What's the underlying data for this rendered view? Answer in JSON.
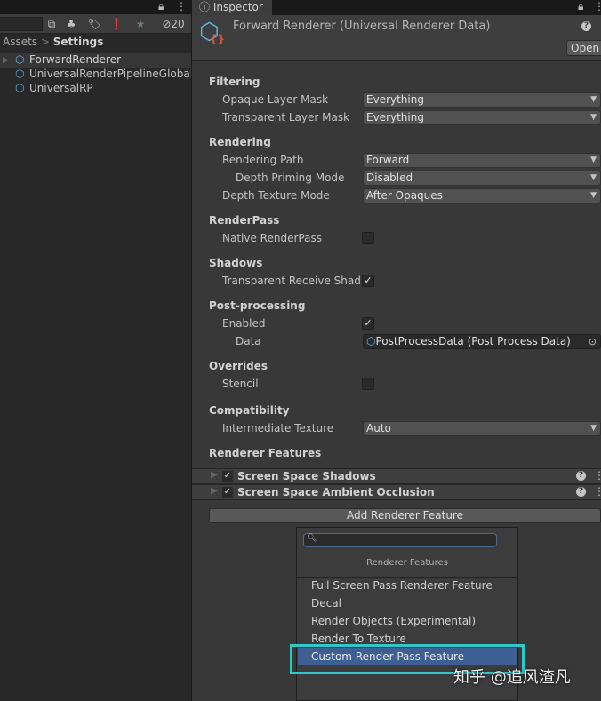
{
  "project": {
    "hidden_count": "20",
    "breadcrumb_root": "Assets",
    "breadcrumb_current": "Settings",
    "items": [
      "ForwardRenderer",
      "UniversalRenderPipelineGlobalSettings",
      "UniversalRP"
    ]
  },
  "inspector": {
    "tab": "Inspector",
    "title": "Forward Renderer (Universal Renderer Data)",
    "open_label": "Open"
  },
  "sections": {
    "filtering": "Filtering",
    "rendering": "Rendering",
    "renderpass": "RenderPass",
    "shadows": "Shadows",
    "post": "Post-processing",
    "overrides": "Overrides",
    "compat": "Compatibility",
    "features": "Renderer Features"
  },
  "fields": {
    "opaque": {
      "label": "Opaque Layer Mask",
      "value": "Everything"
    },
    "transparent": {
      "label": "Transparent Layer Mask",
      "value": "Everything"
    },
    "path": {
      "label": "Rendering Path",
      "value": "Forward"
    },
    "priming": {
      "label": "Depth Priming Mode",
      "value": "Disabled"
    },
    "depthtex": {
      "label": "Depth Texture Mode",
      "value": "After Opaques"
    },
    "native": {
      "label": "Native RenderPass",
      "checked": false
    },
    "transshadow": {
      "label": "Transparent Receive Shadows",
      "checked": true
    },
    "enabled": {
      "label": "Enabled",
      "checked": true
    },
    "data": {
      "label": "Data",
      "value": "PostProcessData (Post Process Data)"
    },
    "stencil": {
      "label": "Stencil",
      "checked": false
    },
    "intermediate": {
      "label": "Intermediate Texture",
      "value": "Auto"
    }
  },
  "renderer_features": [
    "Screen Space Shadows",
    "Screen Space Ambient Occlusion"
  ],
  "add_feature_label": "Add Renderer Feature",
  "popup": {
    "search_value": "",
    "header": "Renderer Features",
    "items": [
      "Full Screen Pass Renderer Feature",
      "Decal",
      "Render Objects (Experimental)",
      "Render To Texture",
      "Custom Render Pass Feature"
    ],
    "selected": "Custom Render Pass Feature"
  },
  "watermark": "知乎 @追风渣凡",
  "colors": {
    "selection": "#3d5f94",
    "highlight_box": "#2fc8c8",
    "asset_icon": "#5fb3e0",
    "asset_badge": "#e0543a"
  }
}
